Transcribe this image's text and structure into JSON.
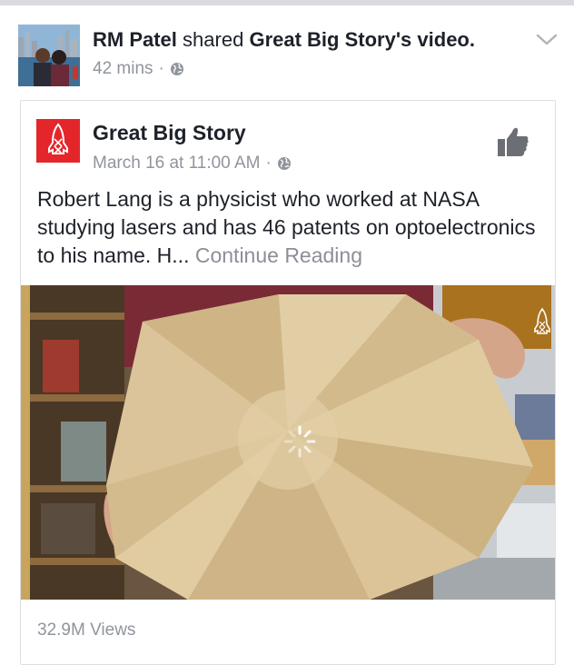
{
  "outer_post": {
    "user_name": "RM Patel",
    "action_text": "shared",
    "shared_source": "Great Big Story's video.",
    "timestamp": "42 mins",
    "separator": "·",
    "privacy_icon": "globe-icon",
    "menu_icon": "chevron-down-icon"
  },
  "shared_post": {
    "page_name": "Great Big Story",
    "timestamp": "March 16 at 11:00 AM",
    "separator": "·",
    "privacy_icon": "globe-icon",
    "like_icon": "thumbs-up-icon",
    "text": "Robert Lang is a physicist who worked at NASA studying lasers and has 46 patents on optoelectronics to his name. H...",
    "continue_label": "Continue Reading",
    "video": {
      "state": "loading",
      "loading_icon": "spinner-icon",
      "watermark_icon": "rocket-logo-icon"
    },
    "views": "32.9M Views"
  },
  "colors": {
    "page_logo_bg": "#e4262b",
    "meta_text": "#90949c",
    "link_gray": "#8b8f96"
  }
}
